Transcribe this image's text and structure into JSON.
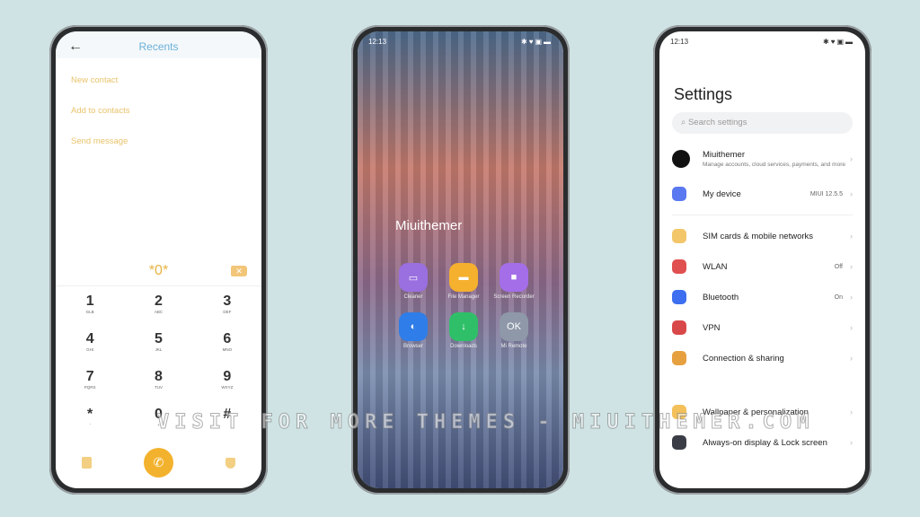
{
  "status": {
    "time": "12:13",
    "icons": "✱♥▣▬"
  },
  "dialer": {
    "title": "Recents",
    "menu": [
      "New contact",
      "Add to contacts",
      "Send message"
    ],
    "input": "*0*",
    "keys": [
      [
        "1",
        "GLB"
      ],
      [
        "2",
        "ABC"
      ],
      [
        "3",
        "DEF"
      ],
      [
        "4",
        "GHI"
      ],
      [
        "5",
        "JKL"
      ],
      [
        "6",
        "MNO"
      ],
      [
        "7",
        "PQRS"
      ],
      [
        "8",
        "TUV"
      ],
      [
        "9",
        "WXYZ"
      ],
      [
        "*",
        "'"
      ],
      [
        "0",
        "+"
      ],
      [
        "#",
        ""
      ]
    ]
  },
  "home": {
    "title": "Miuithemer",
    "apps": [
      {
        "label": "Cleaner",
        "color": "#9a6fe0",
        "glyph": "▭"
      },
      {
        "label": "File Manager",
        "color": "#f5b02e",
        "glyph": "▬"
      },
      {
        "label": "Screen Recorder",
        "color": "#a46ee8",
        "glyph": "■"
      },
      {
        "label": "Browser",
        "color": "#2f7de8",
        "glyph": "◐"
      },
      {
        "label": "Downloads",
        "color": "#2fbf68",
        "glyph": "↓"
      },
      {
        "label": "Mi Remote",
        "color": "#8e98a8",
        "glyph": "OK"
      }
    ]
  },
  "settings": {
    "title": "Settings",
    "search_placeholder": "Search settings",
    "account": {
      "name": "Miuithemer",
      "desc": "Manage accounts, cloud services, payments, and more"
    },
    "device": {
      "label": "My device",
      "value": "MIUI 12.5.5"
    },
    "items": [
      {
        "label": "SIM cards & mobile networks",
        "value": "",
        "color": "#f3c66a"
      },
      {
        "label": "WLAN",
        "value": "Off",
        "color": "#e05050"
      },
      {
        "label": "Bluetooth",
        "value": "On",
        "color": "#3d6ff0"
      },
      {
        "label": "VPN",
        "value": "",
        "color": "#d94848"
      },
      {
        "label": "Connection & sharing",
        "value": "",
        "color": "#e7a040"
      }
    ],
    "items2": [
      {
        "label": "Wallpaper & personalization",
        "color": "#f3c05a"
      },
      {
        "label": "Always-on display & Lock screen",
        "color": "#3a3d45"
      }
    ]
  },
  "watermark": "VISIT FOR MORE THEMES - MIUITHEMER.COM"
}
